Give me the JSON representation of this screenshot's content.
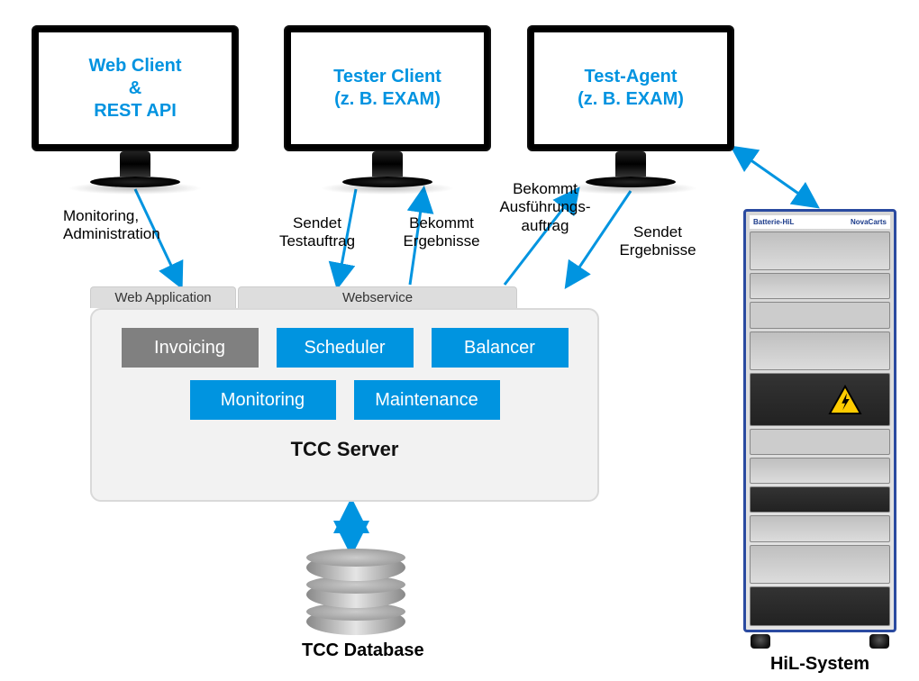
{
  "monitors": {
    "web_client": "Web Client\n&\nREST API",
    "tester_client": "Tester Client\n(z. B. EXAM)",
    "test_agent": "Test-Agent\n(z. B. EXAM)"
  },
  "edges": {
    "monitoring_admin": "Monitoring,\nAdministration",
    "sendet_testauftrag": "Sendet\nTestauftrag",
    "bekommt_ergebnisse": "Bekommt\nErgebnisse",
    "bekommt_auftrag": "Bekommt\nAusführungs-\nauftrag",
    "sendet_ergebnisse": "Sendet\nErgebnisse"
  },
  "server": {
    "tab_web": "Web Application",
    "tab_ws": "Webservice",
    "modules": {
      "invoicing": "Invoicing",
      "scheduler": "Scheduler",
      "balancer": "Balancer",
      "monitoring": "Monitoring",
      "maintenance": "Maintenance"
    },
    "title": "TCC Server"
  },
  "database": {
    "label": "TCC Database"
  },
  "rack": {
    "brand_left": "Batterie-HiL",
    "brand_right": "NovaCarts",
    "label": "HiL-System"
  },
  "colors": {
    "accent_blue": "#0094e0",
    "module_gray": "#808080",
    "rack_frame": "#2a4aa0"
  }
}
